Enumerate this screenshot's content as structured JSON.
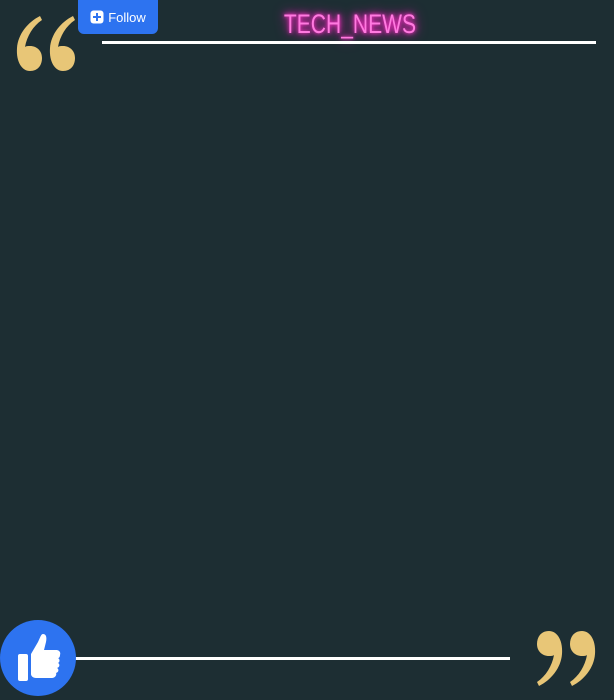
{
  "header": {
    "title": "TECH_NEWS",
    "follow_label": "Follow"
  },
  "icons": {
    "follow": "plus-icon",
    "like": "thumbs-up-icon",
    "open_quote": "open-quote-icon",
    "close_quote": "close-quote-icon"
  },
  "colors": {
    "background": "#1d2e33",
    "accent_pink": "#ff7ae0",
    "quote_gold": "#e8c677",
    "button_blue": "#2d73f0"
  }
}
